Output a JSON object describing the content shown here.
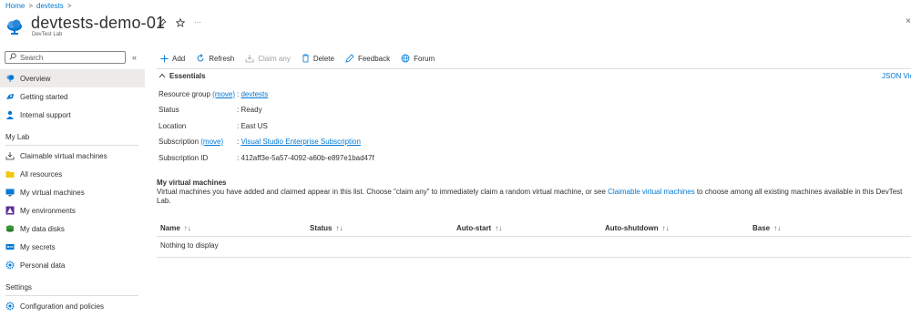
{
  "breadcrumb": {
    "home": "Home",
    "sep1": ">",
    "lab": "devtests",
    "sep2": ">"
  },
  "header": {
    "title": "devtests-demo-01",
    "subtitle": "DevTest Lab",
    "pin_icon": "pin-icon",
    "star_icon": "star-icon",
    "more": "···",
    "close": "×"
  },
  "sidebar": {
    "search_placeholder": "Search",
    "collapse": "«",
    "items": [
      {
        "label": "Overview",
        "icon": "devtest-lab-icon",
        "active": true
      },
      {
        "label": "Getting started",
        "icon": "rocket-icon"
      },
      {
        "label": "Internal support",
        "icon": "support-person-icon"
      }
    ],
    "section_mylab": "My Lab",
    "mylab_items": [
      {
        "label": "Claimable virtual machines",
        "icon": "download-icon"
      },
      {
        "label": "All resources",
        "icon": "folder-icon"
      },
      {
        "label": "My virtual machines",
        "icon": "vm-icon"
      },
      {
        "label": "My environments",
        "icon": "environment-icon"
      },
      {
        "label": "My data disks",
        "icon": "disk-icon"
      },
      {
        "label": "My secrets",
        "icon": "secrets-icon"
      },
      {
        "label": "Personal data",
        "icon": "gear-icon"
      }
    ],
    "section_settings": "Settings",
    "settings_items": [
      {
        "label": "Configuration and policies",
        "icon": "gear-icon"
      }
    ]
  },
  "toolbar": {
    "add": "Add",
    "refresh": "Refresh",
    "claim_any": "Claim any",
    "delete": "Delete",
    "feedback": "Feedback",
    "forum": "Forum"
  },
  "essentials": {
    "title": "Essentials",
    "json_view": "JSON View",
    "rows": [
      {
        "label": "Resource group",
        "action": "(move)",
        "value": "devtests",
        "is_link": true
      },
      {
        "label": "Status",
        "value": "Ready"
      },
      {
        "label": "Location",
        "value": "East US"
      },
      {
        "label": "Subscription",
        "action": "(move)",
        "value": "Visual Studio Enterprise Subscription",
        "is_link": true
      },
      {
        "label": "Subscription ID",
        "value": "412aff3e-5a57-4092-a60b-e897e1bad47f"
      }
    ]
  },
  "vms": {
    "title": "My virtual machines",
    "desc_part1": "Virtual machines you have added and claimed appear in this list. Choose \"claim any\" to immediately claim a random virtual machine, or see ",
    "desc_link": "Claimable virtual machines",
    "desc_part2": " to choose among all existing machines available in this DevTest Lab.",
    "columns": [
      "Name",
      "Status",
      "Auto-start",
      "Auto-shutdown",
      "Base"
    ],
    "sort_glyph": "↑↓",
    "empty": "Nothing to display"
  },
  "colors": {
    "accent": "#0078d4",
    "active_bg": "#edebe9",
    "text": "#323130",
    "muted": "#605e5c"
  }
}
